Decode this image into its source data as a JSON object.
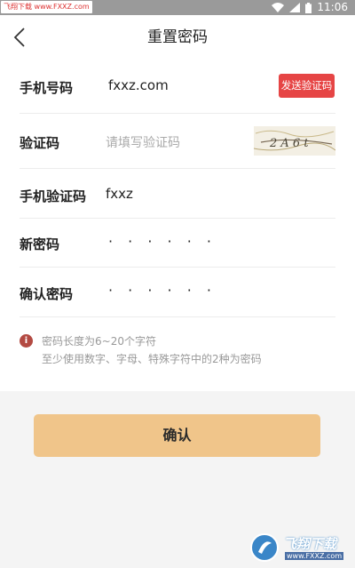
{
  "status_bar": {
    "watermark": "飞翔下载 www.FXXZ.com",
    "time": "11:06"
  },
  "header": {
    "title": "重置密码"
  },
  "form": {
    "phone": {
      "label": "手机号码",
      "value": "fxxz.com",
      "send_button": "发送验证码"
    },
    "captcha": {
      "label": "验证码",
      "placeholder": "请填写验证码",
      "image_text": "2 A 6 t"
    },
    "sms_code": {
      "label": "手机验证码",
      "value": "fxxz"
    },
    "new_password": {
      "label": "新密码",
      "value": "· · · · · ·"
    },
    "confirm_password": {
      "label": "确认密码",
      "value": "· · · · · ·"
    }
  },
  "hint": {
    "icon": "info-icon",
    "line1": "密码长度为6~20个字符",
    "line2": "至少使用数字、字母、特殊字符中的2种为密码"
  },
  "confirm_button": "确认",
  "watermark_bottom": {
    "text": "飞翔下载",
    "url": "www.FXXZ.com"
  },
  "colors": {
    "accent_button": "#f0c58a",
    "send_button": "#e64545",
    "hint_icon": "#b34a42"
  }
}
